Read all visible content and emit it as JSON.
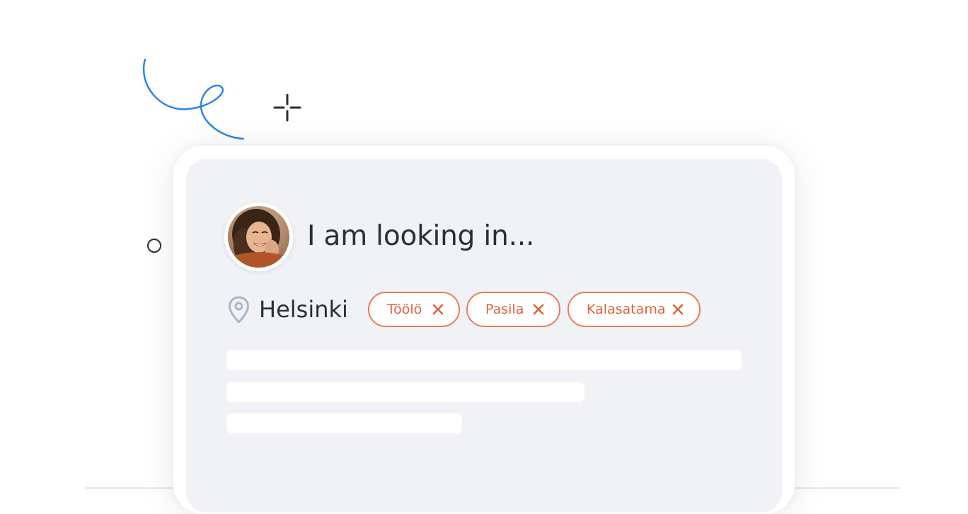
{
  "card": {
    "heading": "I am looking in...",
    "avatar_alt": "smiling woman avatar"
  },
  "location": {
    "icon": "location-pin-icon",
    "city": "Helsinki"
  },
  "chips": [
    {
      "label": "Töölö",
      "remove_icon": "close-icon"
    },
    {
      "label": "Pasila",
      "remove_icon": "close-icon"
    },
    {
      "label": "Kalasatama",
      "remove_icon": "close-icon"
    }
  ],
  "colors": {
    "accent": "#e1603d",
    "accent_border": "#ec7a5c",
    "screen_background": "#f0f2f5",
    "text": "#2c2f36",
    "squiggle": "#2b86e2",
    "pin": "#a9b7c6"
  }
}
